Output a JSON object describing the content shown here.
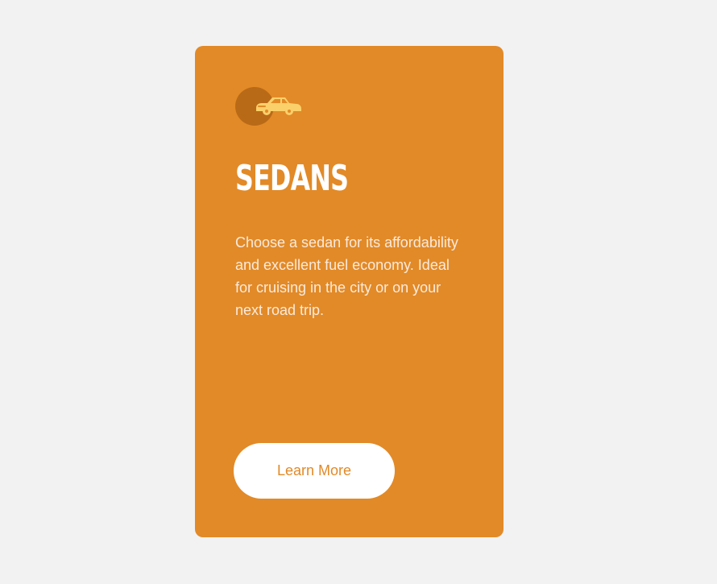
{
  "card": {
    "icon": "sedan-car-icon",
    "title": "SEDANS",
    "description": "Choose a sedan for its affordability and excellent fuel economy. Ideal for cruising in the city or on your next road trip.",
    "button_label": "Learn More"
  },
  "colors": {
    "page_background": "#f2f2f2",
    "card_background": "#e28a27",
    "icon_circle": "#b96a17",
    "icon_car": "#fbd06a",
    "title_text": "#ffffff",
    "description_text": "#fbeadd",
    "button_background": "#ffffff",
    "button_text": "#e28a27"
  }
}
